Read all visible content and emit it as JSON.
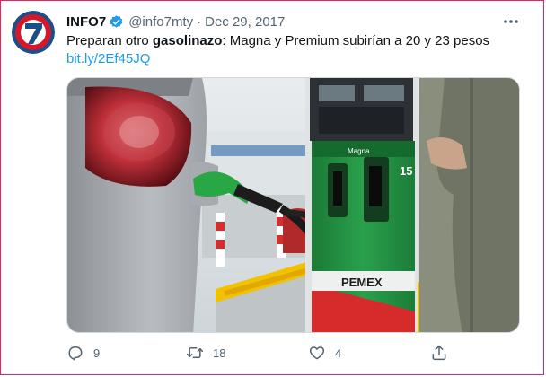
{
  "account": {
    "name": "INFO7",
    "handle": "@info7mty",
    "separator": "·",
    "date": "Dec 29, 2017",
    "avatar_icon": "info7-logo-icon",
    "verified_icon": "verified-badge-icon"
  },
  "tweet": {
    "text_before": "Preparan otro ",
    "text_bold": "gasolinazo",
    "text_after": ": Magna y Premium subirían a 20 y 23 pesos",
    "link": "bit.ly/2Ef45JQ"
  },
  "media": {
    "pump_number": "15",
    "pump_labels": [
      "pemex",
      "Magna"
    ],
    "brand": "PEMEX"
  },
  "actions": {
    "reply_count": "9",
    "retweet_count": "18",
    "like_count": "4",
    "icons": [
      "reply-icon",
      "retweet-icon",
      "like-icon",
      "share-icon"
    ]
  },
  "colors": {
    "accent": "#1d9bf0",
    "secondary_text": "#536471",
    "border_highlight": "#e0245e",
    "avatar_red": "#d7182a",
    "avatar_blue": "#1b4f8a",
    "pemex_green": "#1a8a3a"
  }
}
